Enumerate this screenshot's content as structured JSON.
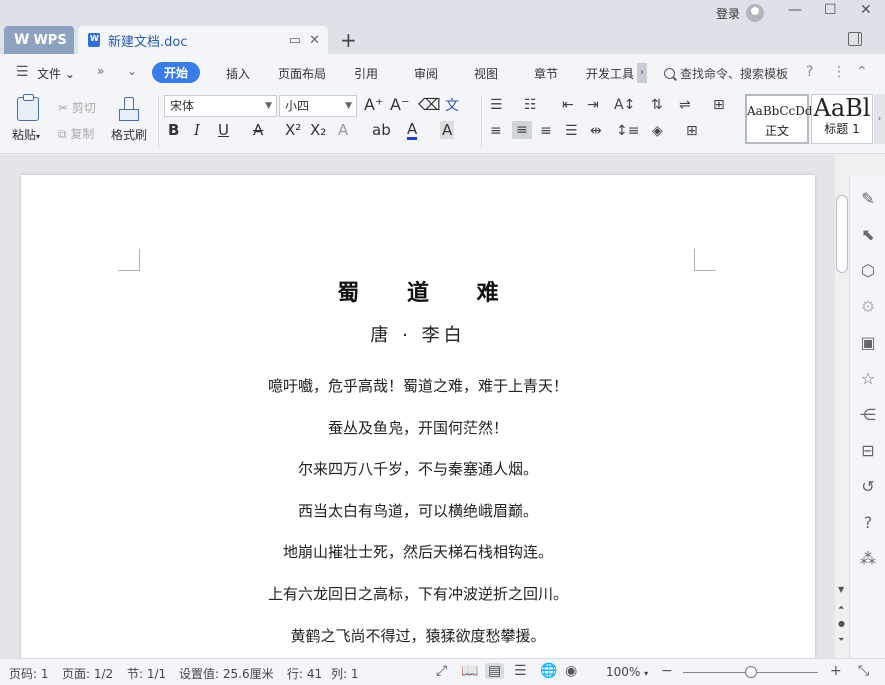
{
  "titlebar": {
    "app_tab": "WPS",
    "doc_tab": "新建文档.doc",
    "login": "登录"
  },
  "menu": {
    "file": "文件",
    "tabs": [
      "开始",
      "插入",
      "页面布局",
      "引用",
      "审阅",
      "视图",
      "章节",
      "开发工具"
    ],
    "active_tab": "开始",
    "search": "查找命令、搜索模板"
  },
  "ribbon": {
    "paste": "粘贴",
    "cut": "剪切",
    "copy": "复制",
    "format_painter": "格式刷",
    "font_name": "宋体",
    "font_size": "小四",
    "styles": [
      {
        "sample": "AaBbCcDd",
        "name": "正文"
      },
      {
        "sample": "AaBl",
        "name": "标题 1"
      }
    ]
  },
  "document": {
    "title": "蜀 道 难",
    "author": "唐 · 李白",
    "lines": [
      "噫吁嚱，危乎高哉！蜀道之难，难于上青天！",
      "蚕丛及鱼凫，开国何茫然！",
      "尔来四万八千岁，不与秦塞通人烟。",
      "西当太白有鸟道，可以横绝峨眉巅。",
      "地崩山摧壮士死，然后天梯石栈相钩连。",
      "上有六龙回日之高标，下有冲波逆折之回川。",
      "黄鹤之飞尚不得过，猿猱欲度愁攀援。"
    ]
  },
  "status": {
    "page_num": "页码: 1",
    "pages": "页面: 1/2",
    "section": "节: 1/1",
    "setting": "设置值: 25.6厘米",
    "row": "行: 41",
    "col": "列: 1",
    "zoom": "100%"
  },
  "icons": {
    "cut": "scissors-icon",
    "copy": "copy-icon",
    "paste": "clipboard-icon",
    "painter": "brush-icon"
  },
  "colors": {
    "accent": "#3b7ce8",
    "doc_tab_text": "#2a5aa8",
    "font_color_underline": "#1f3fbf"
  }
}
